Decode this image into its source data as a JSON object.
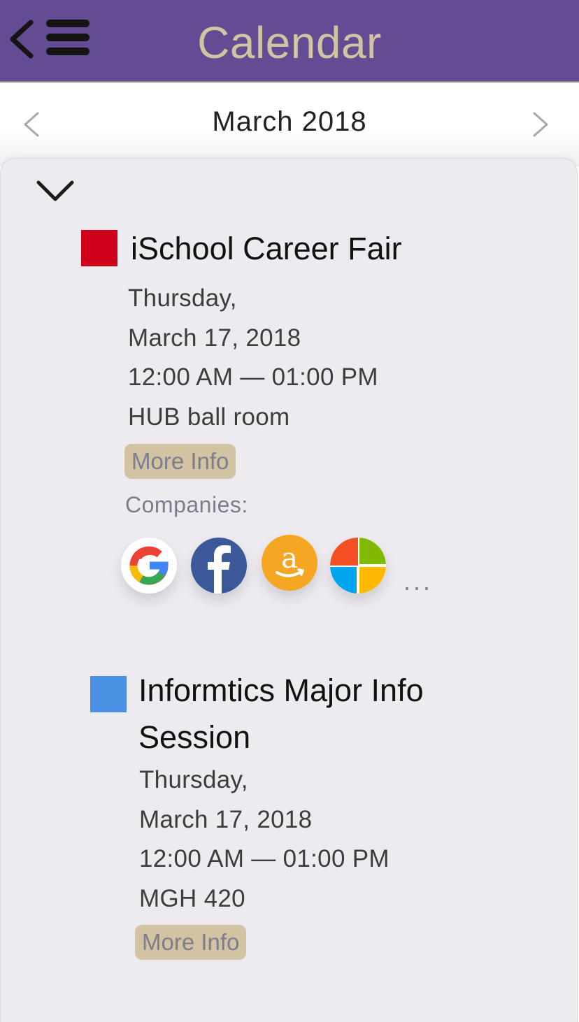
{
  "header": {
    "title": "Calendar",
    "back_icon": "chevron-left-icon",
    "menu_icon": "hamburger-menu-icon",
    "background_color": "#644c94",
    "title_color": "#d2c3a2"
  },
  "month_nav": {
    "title": "March 2018",
    "prev_icon": "chevron-left-icon",
    "next_icon": "chevron-right-icon"
  },
  "sheet": {
    "collapse_icon": "chevron-down-icon"
  },
  "events": [
    {
      "color": "#d0021b",
      "title": "iSchool Career Fair",
      "day": "Thursday,",
      "date": "March 17, 2018",
      "time": "12:00 AM — 01:00 PM",
      "location": "HUB ball room",
      "more_info_label": "More Info",
      "companies_label": "Companies:",
      "companies": [
        {
          "name": "Google",
          "icon": "google-logo-icon"
        },
        {
          "name": "Facebook",
          "icon": "facebook-logo-icon"
        },
        {
          "name": "Amazon",
          "icon": "amazon-logo-icon"
        },
        {
          "name": "Microsoft",
          "icon": "microsoft-logo-icon"
        }
      ],
      "companies_more": "..."
    },
    {
      "color": "#4a90e2",
      "title_line1": "Informtics Major Info",
      "title_line2": "Session",
      "day": "Thursday,",
      "date": "March 17, 2018",
      "time": "12:00 AM — 01:00 PM",
      "location": "MGH 420",
      "more_info_label": "More Info"
    }
  ],
  "button_color": "#d2c4a2"
}
